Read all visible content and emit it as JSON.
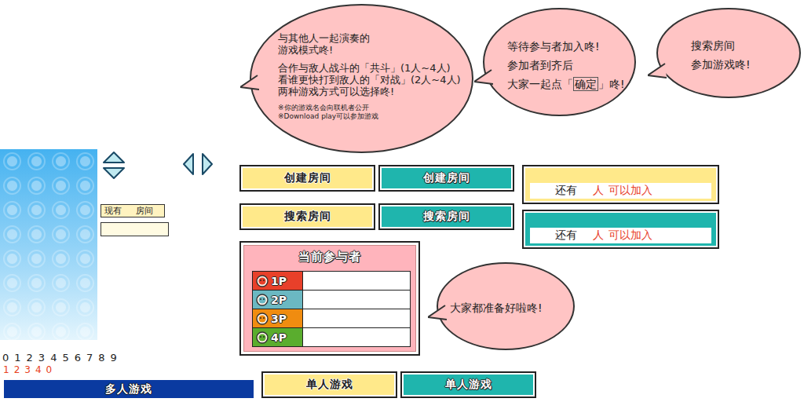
{
  "bubbles": [
    {
      "paragraphs": [
        {
          "kind": "body",
          "lines": [
            [
              {
                "text": "与其他人一起演奏的",
                "boxed": false
              }
            ],
            [
              {
                "text": "游戏模式咚!",
                "boxed": false
              }
            ]
          ]
        },
        {
          "kind": "body",
          "lines": [
            [
              {
                "text": "合作与敌人战斗的「共斗」(1人~4人)",
                "boxed": false
              }
            ],
            [
              {
                "text": "看谁更快打到敌人的「对战」(2人~4人)",
                "boxed": false
              }
            ],
            [
              {
                "text": "两种游戏方式可以选择咚!",
                "boxed": false
              }
            ]
          ]
        },
        {
          "kind": "note",
          "lines": [
            [
              {
                "text": "※你的游戏名会向联机者公开",
                "boxed": false
              }
            ],
            [
              {
                "text": "※Download play可以参加游戏",
                "boxed": false
              }
            ]
          ]
        }
      ]
    },
    {
      "paragraphs": [
        {
          "kind": "body",
          "lines": [
            [
              {
                "text": "等待参与者加入咚!",
                "boxed": false
              }
            ],
            [
              {
                "text": "参加者到齐后",
                "boxed": false
              }
            ],
            [
              {
                "text": "大家一起点「",
                "boxed": false
              },
              {
                "text": "确定",
                "boxed": true
              },
              {
                "text": "」咚!",
                "boxed": false
              }
            ]
          ]
        }
      ]
    },
    {
      "paragraphs": [
        {
          "kind": "body",
          "lines": [
            [
              {
                "text": "搜索房间",
                "boxed": false
              }
            ],
            [
              {
                "text": "参加游戏咚!",
                "boxed": false
              }
            ]
          ]
        }
      ]
    },
    {
      "paragraphs": [
        {
          "kind": "body",
          "lines": [
            [
              {
                "text": "大家都准备好啦咚!",
                "boxed": false
              }
            ]
          ]
        }
      ]
    }
  ],
  "room_counter": {
    "parts": [
      "现有",
      "房间"
    ]
  },
  "lobby_buttons": [
    {
      "label": "创建房间",
      "kind": "light"
    },
    {
      "label": "创建房间",
      "kind": "dark"
    },
    {
      "label": "搜索房间",
      "kind": "light"
    },
    {
      "label": "搜索房间",
      "kind": "dark"
    }
  ],
  "slot_boxes": [
    {
      "kind": "light",
      "parts": [
        {
          "text": "还有",
          "color": "#222222"
        },
        {
          "text": "人",
          "color": "#e8402a"
        },
        {
          "text": "可以加入",
          "color": "#e8402a"
        }
      ]
    },
    {
      "kind": "dark",
      "parts": [
        {
          "text": "还有",
          "color": "#222222"
        },
        {
          "text": "人",
          "color": "#e8402a"
        },
        {
          "text": "可以加入",
          "color": "#e8402a"
        }
      ]
    }
  ],
  "participants": {
    "title": "当前参与者",
    "players": [
      {
        "label": "1P",
        "color": "#e8402a"
      },
      {
        "label": "2P",
        "color": "#6bb8c2"
      },
      {
        "label": "3P",
        "color": "#f08c10"
      },
      {
        "label": "4P",
        "color": "#5aad2e"
      }
    ]
  },
  "digits": [
    "0",
    "1",
    "2",
    "3",
    "4",
    "5",
    "6",
    "7",
    "8",
    "9"
  ],
  "digits_red": [
    "1",
    "2",
    "3",
    "4",
    "0"
  ],
  "mode_bar": {
    "label": "多人游戏"
  },
  "mode_buttons": [
    {
      "label": "单人游戏",
      "kind": "light"
    },
    {
      "label": "单人游戏",
      "kind": "dark"
    }
  ]
}
